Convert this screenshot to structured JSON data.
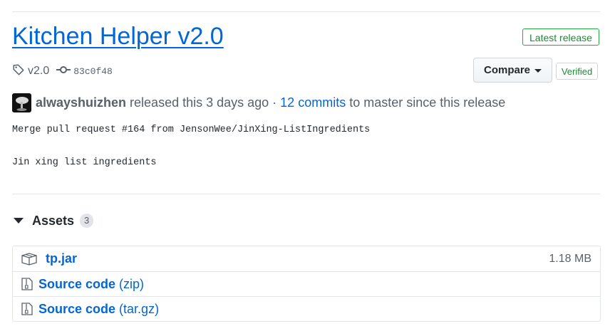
{
  "release": {
    "title": "Kitchen Helper v2.0",
    "latest_badge": "Latest release",
    "tag": "v2.0",
    "commit": "83c0f48",
    "compare_label": "Compare",
    "verified_label": "Verified"
  },
  "author": {
    "name": "alwayshuizhen",
    "released_text": "released this 3 days ago ·",
    "commits_link": "12 commits",
    "tail_text": "to master since this release"
  },
  "notes": {
    "line1": "Merge pull request #164 from JensonWee/JinXing-ListIngredients",
    "line2": "Jin xing list ingredients"
  },
  "assets": {
    "heading": "Assets",
    "count": "3",
    "items": [
      {
        "name": "tp.jar",
        "suffix": "",
        "size": "1.18 MB",
        "icon": "package-icon"
      },
      {
        "name": "Source code",
        "suffix": "(zip)",
        "size": "",
        "icon": "file-zip-icon"
      },
      {
        "name": "Source code",
        "suffix": "(tar.gz)",
        "size": "",
        "icon": "file-zip-icon"
      }
    ]
  },
  "colors": {
    "link": "#0366d6",
    "success": "#28a745",
    "muted": "#586069",
    "border": "#e1e4e8"
  }
}
